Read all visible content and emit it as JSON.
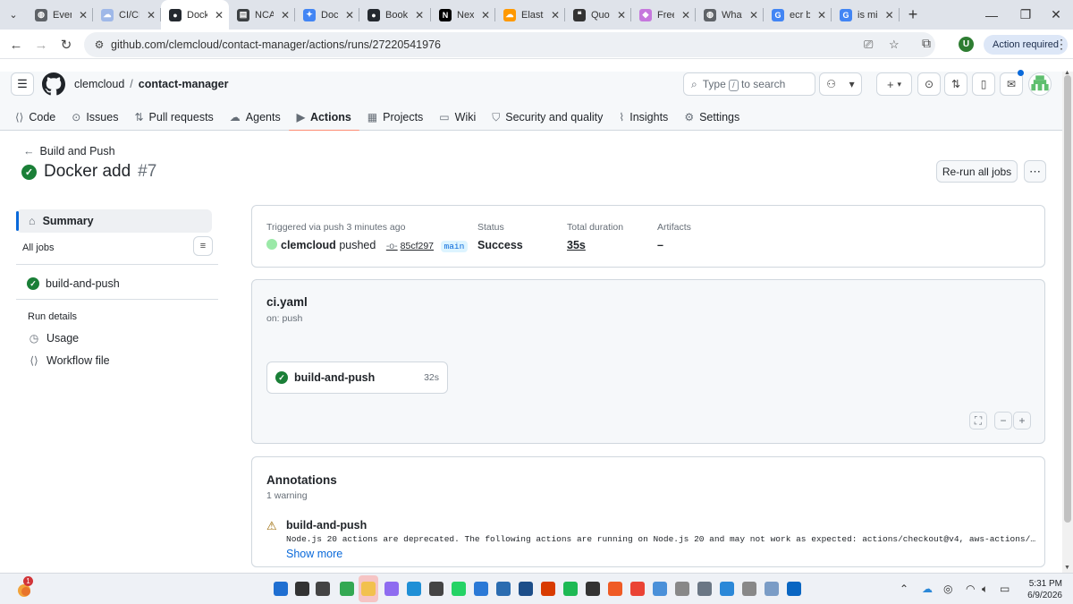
{
  "browser": {
    "tabs": [
      {
        "title": "Event",
        "favicon": "globe",
        "color": "#5f6368"
      },
      {
        "title": "CI/CD",
        "favicon": "cloud",
        "color": "#9fb8e8"
      },
      {
        "title": "Dock",
        "favicon": "github",
        "color": "#24292f",
        "active": true
      },
      {
        "title": "NCAI",
        "favicon": "ncai",
        "color": "#3c4043"
      },
      {
        "title": "Dock",
        "favicon": "gemini",
        "color": "#4285f4"
      },
      {
        "title": "Book",
        "favicon": "github",
        "color": "#24292f"
      },
      {
        "title": "Next",
        "favicon": "nextjs",
        "color": "#000000"
      },
      {
        "title": "Elasti",
        "favicon": "cloud",
        "color": "#ff9900"
      },
      {
        "title": "Quot",
        "favicon": "quote",
        "color": "#333333"
      },
      {
        "title": "Free",
        "favicon": "cube",
        "color": "#c678dd"
      },
      {
        "title": "What",
        "favicon": "globe",
        "color": "#5f6368"
      },
      {
        "title": "ecr b",
        "favicon": "google",
        "color": "#4285f4"
      },
      {
        "title": "is mi",
        "favicon": "google",
        "color": "#4285f4"
      }
    ],
    "url": "github.com/clemcloud/contact-manager/actions/runs/27220541976",
    "profile_initial": "U",
    "action_required": "Action required"
  },
  "github": {
    "owner": "clemcloud",
    "separator": "/",
    "repo": "contact-manager",
    "search_prefix": "Type",
    "search_key": "/",
    "search_suffix": "to search",
    "nav": [
      {
        "label": "Code",
        "icon": "code"
      },
      {
        "label": "Issues",
        "icon": "issue"
      },
      {
        "label": "Pull requests",
        "icon": "pull-request"
      },
      {
        "label": "Agents",
        "icon": "agent"
      },
      {
        "label": "Actions",
        "icon": "play",
        "selected": true
      },
      {
        "label": "Projects",
        "icon": "table"
      },
      {
        "label": "Wiki",
        "icon": "book"
      },
      {
        "label": "Security and quality",
        "icon": "shield"
      },
      {
        "label": "Insights",
        "icon": "graph"
      },
      {
        "label": "Settings",
        "icon": "gear"
      }
    ]
  },
  "run": {
    "back_label": "Build and Push",
    "title": "Docker add",
    "number": "#7",
    "rerun_label": "Re-run all jobs"
  },
  "sidebar": {
    "summary_label": "Summary",
    "all_jobs_label": "All jobs",
    "job_label": "build-and-push",
    "run_details_label": "Run details",
    "usage_label": "Usage",
    "workflow_file_label": "Workflow file"
  },
  "summary": {
    "trigger_label": "Triggered via push 3 minutes ago",
    "actor": "clemcloud",
    "action": "pushed",
    "sha": "85cf297",
    "branch": "main",
    "status_label": "Status",
    "status_value": "Success",
    "duration_label": "Total duration",
    "duration_value": "35s",
    "artifacts_label": "Artifacts",
    "artifacts_value": "–"
  },
  "workflow": {
    "file": "ci.yaml",
    "trigger": "on: push",
    "job": {
      "name": "build-and-push",
      "duration": "32s"
    }
  },
  "annotations": {
    "title": "Annotations",
    "count": "1 warning",
    "job": "build-and-push",
    "message": "Node.js 20 actions are deprecated. The following actions are running on Node.js 20 and may not work as expected: actions/checkout@v4, aws-actions/configure-aws-c…",
    "show_more": "Show more"
  },
  "taskbar": {
    "time": "5:31 PM",
    "date": "6/9/2026",
    "weather_badge": "1"
  }
}
